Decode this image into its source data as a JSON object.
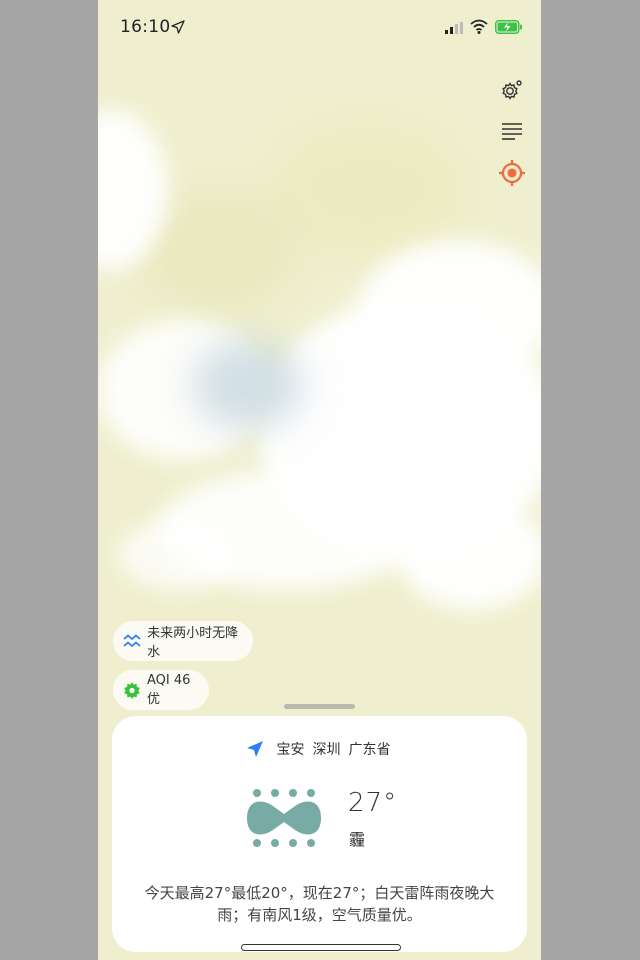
{
  "status_bar": {
    "time": "16:10",
    "icons": [
      "location-arrow-icon",
      "cellular-signal-icon",
      "wifi-icon",
      "battery-charging-icon"
    ],
    "battery_color": "#3cc24a"
  },
  "side_toolbar": {
    "icons": [
      "settings-icon",
      "list-icon",
      "locate-icon"
    ],
    "accent": "#ef6a3a"
  },
  "chips": {
    "rain_forecast": "未来两小时无降水",
    "aqi": "AQI 46 优"
  },
  "card": {
    "location": {
      "district": "宝安",
      "city": "深圳",
      "province": "广东省"
    },
    "weather_icon": "fog-icon",
    "temperature": "27°",
    "condition": "霾",
    "summary": "今天最高27°最低20°，现在27°；白天雷阵雨夜晚大雨；有南风1级，空气质量优。"
  },
  "colors": {
    "nav_blue": "#2f7df6",
    "icon_teal": "#78aaa6",
    "aqi_green": "#39c23c"
  }
}
